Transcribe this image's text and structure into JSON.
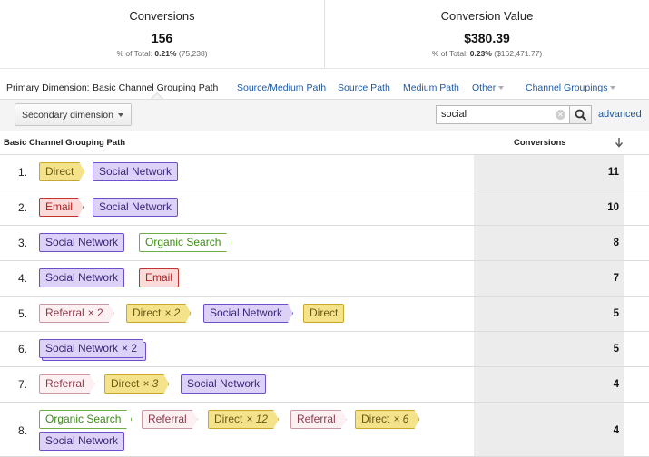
{
  "summary": {
    "conversions": {
      "title": "Conversions",
      "value": "156",
      "pct_prefix": "% of Total:",
      "pct": "0.21%",
      "total": "(75,238)"
    },
    "conversion_value": {
      "title": "Conversion Value",
      "value": "$380.39",
      "pct_prefix": "% of Total:",
      "pct": "0.23%",
      "total": "($162,471.77)"
    }
  },
  "dimensions": {
    "label": "Primary Dimension:",
    "active": "Basic Channel Grouping Path",
    "links": [
      "Source/Medium Path",
      "Source Path",
      "Medium Path",
      "Other"
    ],
    "channel_groupings": "Channel Groupings"
  },
  "toolbar": {
    "secondary_dimension": "Secondary dimension",
    "search_value": "social",
    "advanced": "advanced"
  },
  "table": {
    "col_path": "Basic Channel Grouping Path",
    "col_conversions": "Conversions",
    "rows": [
      {
        "index": "1.",
        "value": "11",
        "chips": [
          {
            "label": "Direct",
            "type": "direct"
          },
          {
            "label": "Social Network",
            "type": "social"
          }
        ]
      },
      {
        "index": "2.",
        "value": "10",
        "chips": [
          {
            "label": "Email",
            "type": "email"
          },
          {
            "label": "Social Network",
            "type": "social"
          }
        ]
      },
      {
        "index": "3.",
        "value": "8",
        "chips": [
          {
            "label": "Social Network",
            "type": "social"
          },
          {
            "label": "Organic Search",
            "type": "organic"
          }
        ]
      },
      {
        "index": "4.",
        "value": "7",
        "chips": [
          {
            "label": "Social Network",
            "type": "social"
          },
          {
            "label": "Email",
            "type": "email"
          }
        ]
      },
      {
        "index": "5.",
        "value": "5",
        "chips": [
          {
            "label": "Referral",
            "mult": "× 2",
            "type": "referral"
          },
          {
            "label": "Direct",
            "mult": "× 2",
            "type": "direct"
          },
          {
            "label": "Social Network",
            "type": "social"
          },
          {
            "label": "Direct",
            "type": "direct"
          }
        ]
      },
      {
        "index": "6.",
        "value": "5",
        "chips": [
          {
            "label": "Social Network",
            "mult": "× 2",
            "type": "social"
          }
        ]
      },
      {
        "index": "7.",
        "value": "4",
        "chips": [
          {
            "label": "Referral",
            "type": "referral"
          },
          {
            "label": "Direct",
            "mult": "× 3",
            "type": "direct"
          },
          {
            "label": "Social Network",
            "type": "social"
          }
        ]
      },
      {
        "index": "8.",
        "value": "4",
        "chips": [
          {
            "label": "Organic Search",
            "type": "organic"
          },
          {
            "label": "Referral",
            "type": "referral"
          },
          {
            "label": "Direct",
            "mult": "× 12",
            "type": "direct"
          },
          {
            "label": "Referral",
            "type": "referral"
          },
          {
            "label": "Direct",
            "mult": "× 6",
            "type": "direct"
          },
          {
            "label": "Social Network",
            "type": "social"
          }
        ]
      }
    ]
  }
}
